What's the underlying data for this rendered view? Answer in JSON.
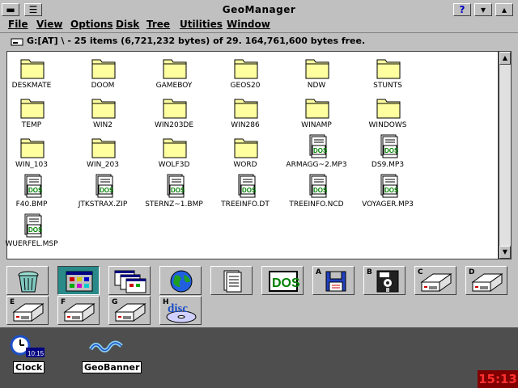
{
  "window": {
    "title": "GeoManager",
    "help_label": "?"
  },
  "menu": [
    "File",
    "View",
    "Options",
    "Disk",
    "Tree",
    "Utilities",
    "Window"
  ],
  "path": "G:[AT] \\ - 25 items (6,721,232 bytes) of 29.  164,761,600 bytes free.",
  "files": [
    {
      "name": "DESKMATE",
      "type": "folder"
    },
    {
      "name": "DOOM",
      "type": "folder"
    },
    {
      "name": "GAMEBOY",
      "type": "folder"
    },
    {
      "name": "GEOS20",
      "type": "folder"
    },
    {
      "name": "NDW",
      "type": "folder"
    },
    {
      "name": "STUNTS",
      "type": "folder"
    },
    {
      "name": "TEMP",
      "type": "folder"
    },
    {
      "name": "WIN2",
      "type": "folder"
    },
    {
      "name": "WIN203DE",
      "type": "folder"
    },
    {
      "name": "WIN286",
      "type": "folder"
    },
    {
      "name": "WINAMP",
      "type": "folder"
    },
    {
      "name": "WINDOWS",
      "type": "folder"
    },
    {
      "name": "WIN_103",
      "type": "folder"
    },
    {
      "name": "WIN_203",
      "type": "folder"
    },
    {
      "name": "WOLF3D",
      "type": "folder"
    },
    {
      "name": "WORD",
      "type": "folder"
    },
    {
      "name": "ARMAGG~2.MP3",
      "type": "dos"
    },
    {
      "name": "DS9.MP3",
      "type": "dos"
    },
    {
      "name": "F40.BMP",
      "type": "dos"
    },
    {
      "name": "JTKSTRAX.ZIP",
      "type": "dos"
    },
    {
      "name": "STERNZ~1.BMP",
      "type": "dos"
    },
    {
      "name": "TREEINFO.DT",
      "type": "dos"
    },
    {
      "name": "TREEINFO.NCD",
      "type": "dos"
    },
    {
      "name": "VOYAGER.MP3",
      "type": "dos"
    },
    {
      "name": "WUERFEL.MSP",
      "type": "dos"
    }
  ],
  "toolbar": {
    "row1": [
      {
        "icon": "wastebasket-icon",
        "letter": ""
      },
      {
        "icon": "grid-view-icon",
        "letter": "",
        "pressed": true
      },
      {
        "icon": "overlap-windows-icon",
        "letter": ""
      },
      {
        "icon": "globe-icon",
        "letter": ""
      },
      {
        "icon": "document-icon",
        "letter": ""
      },
      {
        "icon": "dos-icon",
        "letter": "",
        "text": "DOS"
      },
      {
        "icon": "floppy-35-icon",
        "letter": "A"
      },
      {
        "icon": "floppy-525-icon",
        "letter": "B"
      },
      {
        "icon": "hard-drive-icon",
        "letter": "C"
      },
      {
        "icon": "hard-drive-icon",
        "letter": "D"
      }
    ],
    "row2": [
      {
        "icon": "hard-drive-icon",
        "letter": "E"
      },
      {
        "icon": "hard-drive-icon",
        "letter": "F"
      },
      {
        "icon": "hard-drive-icon",
        "letter": "G"
      },
      {
        "icon": "cd-disc-icon",
        "letter": "H",
        "text": "disc"
      }
    ]
  },
  "desktop": [
    {
      "label": "Clock",
      "time": "10:15"
    },
    {
      "label": "GeoBanner"
    }
  ],
  "system_clock": "15:13",
  "colors": {
    "folder": "#ffffa0",
    "dos_text": "#008000",
    "clock_bg": "#800000",
    "clock_fg": "#ff3030"
  }
}
